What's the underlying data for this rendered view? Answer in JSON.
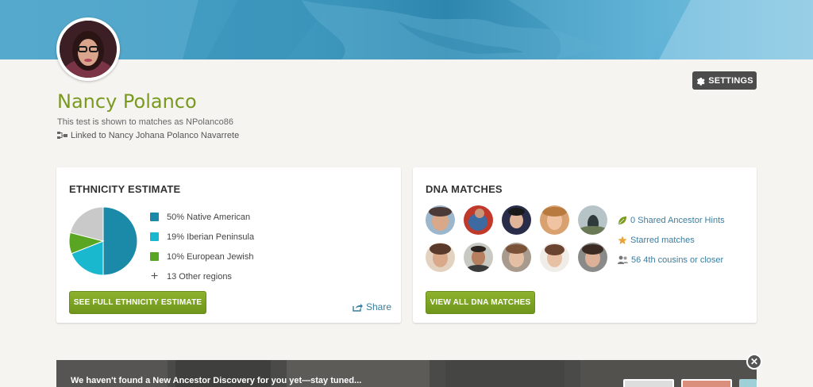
{
  "header": {
    "settings_label": "SETTINGS"
  },
  "profile": {
    "name": "Nancy Polanco",
    "shown_as": "This test is shown to matches as NPolanco86",
    "linked_to": "Linked to Nancy Johana Polanco Navarrete"
  },
  "ethnicity": {
    "title": "ETHNICITY ESTIMATE",
    "items": [
      {
        "label": "50% Native American",
        "color": "#1a8aa8",
        "percent": 50
      },
      {
        "label": "19% Iberian Peninsula",
        "color": "#19b8cf",
        "percent": 19
      },
      {
        "label": "10% European Jewish",
        "color": "#5aa623",
        "percent": 10
      }
    ],
    "other": {
      "label": "13 Other regions",
      "color": "#c9c9c9",
      "percent": 21
    },
    "button": "SEE FULL ETHNICITY ESTIMATE",
    "share": "Share"
  },
  "dna": {
    "title": "DNA MATCHES",
    "links": [
      {
        "label": "0 Shared Ancestor Hints",
        "icon": "leaf-icon"
      },
      {
        "label": "Starred matches",
        "icon": "star-icon"
      },
      {
        "label": "56 4th cousins or closer",
        "icon": "people-icon"
      }
    ],
    "button": "VIEW ALL DNA MATCHES"
  },
  "discovery": {
    "message": "We haven't found a New Ancestor Discovery for you yet—stay tuned..."
  }
}
